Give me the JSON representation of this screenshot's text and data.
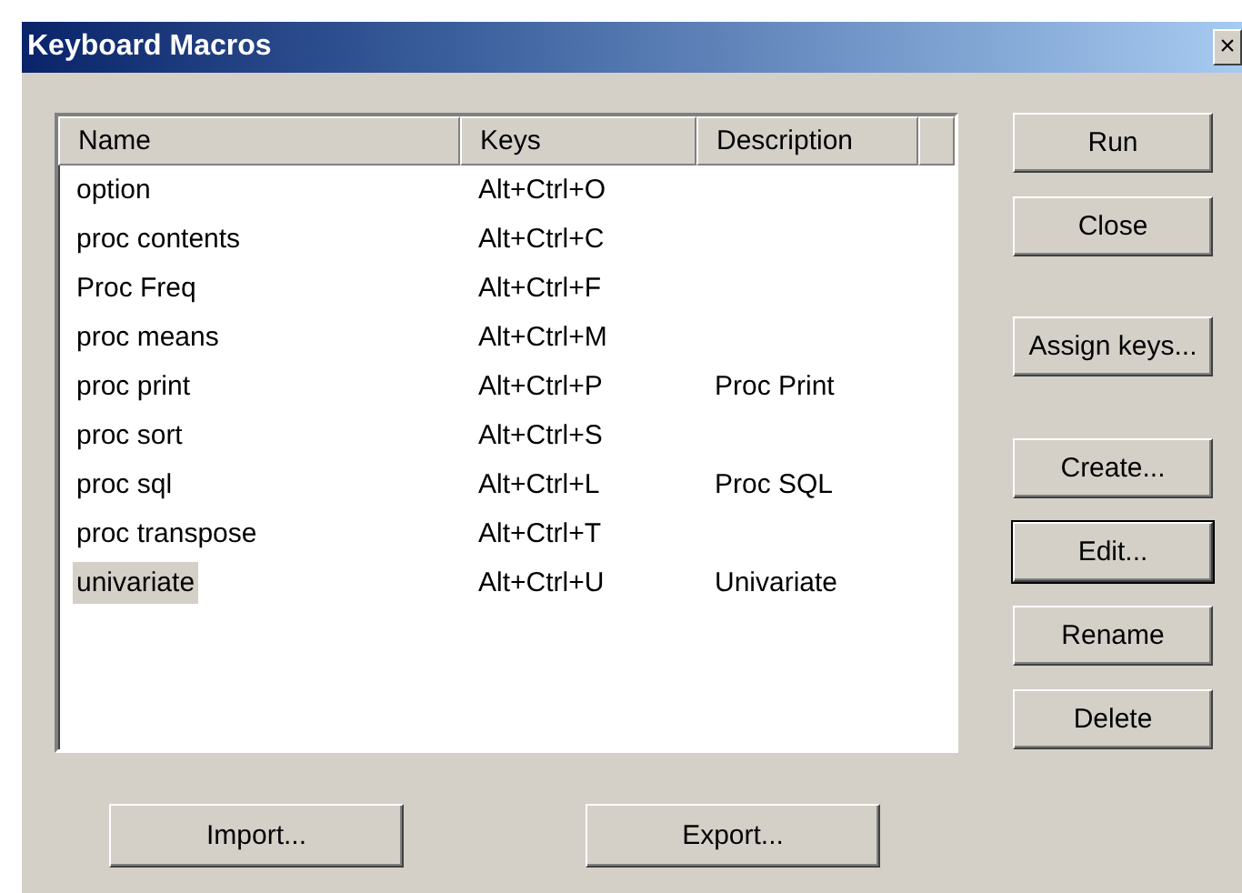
{
  "window": {
    "title": "Keyboard Macros",
    "close": "×"
  },
  "table": {
    "columns": [
      "Name",
      "Keys",
      "Description"
    ],
    "rows": [
      {
        "name": "option",
        "keys": "Alt+Ctrl+O",
        "description": "",
        "selected": false
      },
      {
        "name": "proc contents",
        "keys": "Alt+Ctrl+C",
        "description": "",
        "selected": false
      },
      {
        "name": "Proc Freq",
        "keys": "Alt+Ctrl+F",
        "description": "",
        "selected": false
      },
      {
        "name": "proc means",
        "keys": "Alt+Ctrl+M",
        "description": "",
        "selected": false
      },
      {
        "name": "proc print",
        "keys": "Alt+Ctrl+P",
        "description": "Proc Print",
        "selected": false
      },
      {
        "name": "proc sort",
        "keys": "Alt+Ctrl+S",
        "description": "",
        "selected": false
      },
      {
        "name": "proc sql",
        "keys": "Alt+Ctrl+L",
        "description": "Proc SQL",
        "selected": false
      },
      {
        "name": "proc transpose",
        "keys": "Alt+Ctrl+T",
        "description": "",
        "selected": false
      },
      {
        "name": "univariate",
        "keys": "Alt+Ctrl+U",
        "description": "Univariate",
        "selected": true
      }
    ]
  },
  "side_buttons": [
    {
      "label": "Run",
      "default": false
    },
    {
      "label": "Close",
      "default": false
    },
    {
      "label": "Assign keys...",
      "default": false
    },
    {
      "label": "Create...",
      "default": false
    },
    {
      "label": "Edit...",
      "default": true
    },
    {
      "label": "Rename",
      "default": false
    },
    {
      "label": "Delete",
      "default": false
    }
  ],
  "bottom_buttons": [
    "Import...",
    "Export..."
  ]
}
